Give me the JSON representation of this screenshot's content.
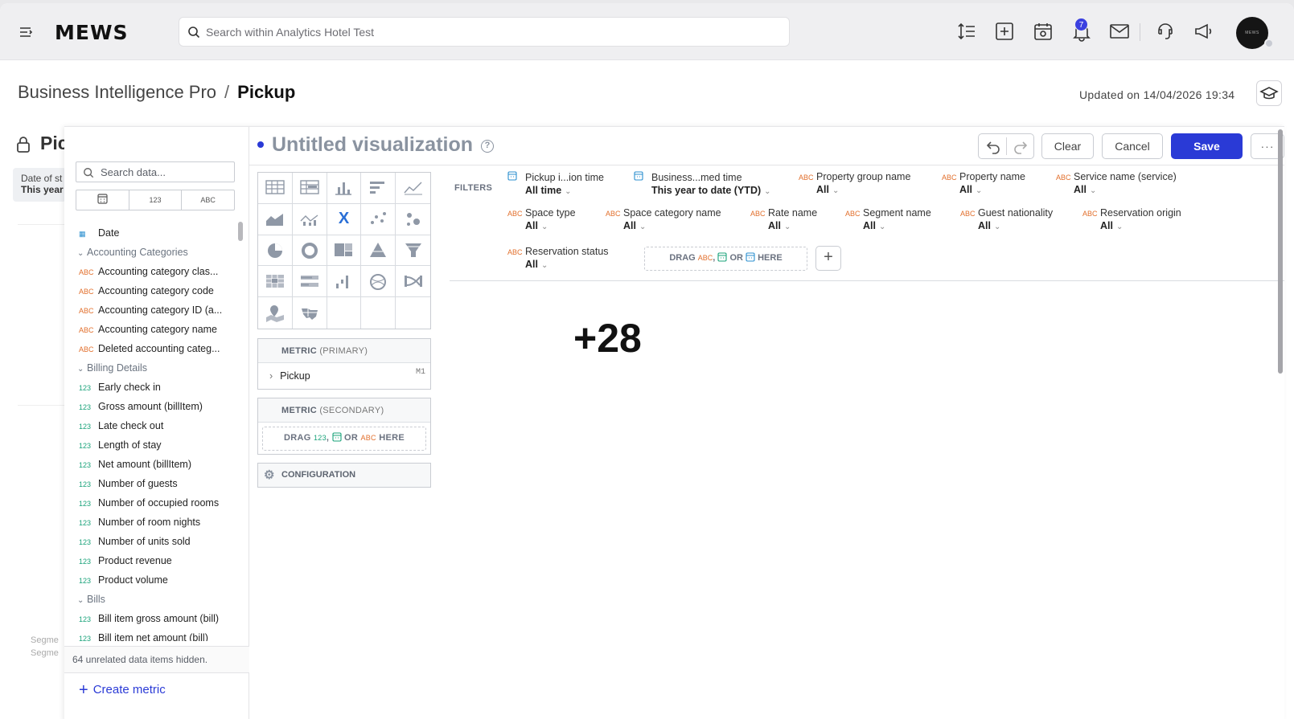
{
  "topbar": {
    "logo": "MEWS",
    "search_placeholder": "Search within Analytics Hotel Test",
    "notification_count": "7",
    "avatar_text": "MEWS"
  },
  "breadcrumb": {
    "parent": "Business Intelligence Pro",
    "separator": "/",
    "current": "Pickup"
  },
  "updated": "Updated on 14/04/2026 19:34",
  "underlying": {
    "title": "Pic",
    "date_label": "Date of st",
    "date_value": "This year",
    "segment_label1": "Segme",
    "segment_label2": "Segme"
  },
  "data_panel": {
    "search_placeholder": "Search data...",
    "type_tabs": [
      "",
      "123",
      "ABC"
    ],
    "items": [
      {
        "kind": "item",
        "type": "date",
        "icon": "▦",
        "label": "Date"
      },
      {
        "kind": "group",
        "label": "Accounting Categories"
      },
      {
        "kind": "item",
        "type": "abc",
        "icon": "ABC",
        "label": "Accounting category clas..."
      },
      {
        "kind": "item",
        "type": "abc",
        "icon": "ABC",
        "label": "Accounting category code"
      },
      {
        "kind": "item",
        "type": "abc",
        "icon": "ABC",
        "label": "Accounting category ID (a..."
      },
      {
        "kind": "item",
        "type": "abc",
        "icon": "ABC",
        "label": "Accounting category name"
      },
      {
        "kind": "item",
        "type": "abc",
        "icon": "ABC",
        "label": "Deleted accounting categ..."
      },
      {
        "kind": "group",
        "label": "Billing Details"
      },
      {
        "kind": "item",
        "type": "num",
        "icon": "123",
        "label": "Early check in"
      },
      {
        "kind": "item",
        "type": "num",
        "icon": "123",
        "label": "Gross amount (billItem)"
      },
      {
        "kind": "item",
        "type": "num",
        "icon": "123",
        "label": "Late check out"
      },
      {
        "kind": "item",
        "type": "num",
        "icon": "123",
        "label": "Length of stay"
      },
      {
        "kind": "item",
        "type": "num",
        "icon": "123",
        "label": "Net amount (billItem)"
      },
      {
        "kind": "item",
        "type": "num",
        "icon": "123",
        "label": "Number of guests"
      },
      {
        "kind": "item",
        "type": "num",
        "icon": "123",
        "label": "Number of occupied rooms"
      },
      {
        "kind": "item",
        "type": "num",
        "icon": "123",
        "label": "Number of room nights"
      },
      {
        "kind": "item",
        "type": "num",
        "icon": "123",
        "label": "Number of units sold"
      },
      {
        "kind": "item",
        "type": "num",
        "icon": "123",
        "label": "Product revenue"
      },
      {
        "kind": "item",
        "type": "num",
        "icon": "123",
        "label": "Product volume"
      },
      {
        "kind": "group",
        "label": "Bills"
      },
      {
        "kind": "item",
        "type": "num",
        "icon": "123",
        "label": "Bill item gross amount (bill)"
      },
      {
        "kind": "item",
        "type": "num",
        "icon": "123",
        "label": "Bill item net amount (bill)"
      }
    ],
    "hidden_note": "64 unrelated data items hidden.",
    "create_metric": "Create metric"
  },
  "editor": {
    "title": "Untitled visualization",
    "help": "?",
    "clear": "Clear",
    "cancel": "Cancel",
    "save": "Save",
    "more": "···"
  },
  "chart_types": [
    "table-icon",
    "pivot-table-icon",
    "column-chart-icon",
    "bar-chart-icon",
    "line-chart-icon",
    "area-chart-icon",
    "combo-chart-icon",
    "headline-icon",
    "scatter-plot-icon",
    "bubble-chart-icon",
    "pie-chart-icon",
    "donut-chart-icon",
    "treemap-icon",
    "pyramid-chart-icon",
    "funnel-chart-icon",
    "heatmap-icon",
    "bullet-chart-icon",
    "waterfall-chart-icon",
    "dependency-wheel-icon",
    "sankey-icon",
    "pushpin-map-icon",
    "region-map-icon",
    "empty",
    "empty",
    "empty"
  ],
  "headline_glyph": "X",
  "metric_primary": {
    "title": "METRIC",
    "qualifier": "(PRIMARY)",
    "item": "Pickup",
    "tag": "M1"
  },
  "metric_secondary": {
    "title": "METRIC",
    "qualifier": "(SECONDARY)",
    "drop_drag": "DRAG",
    "drop_num": "123",
    "drop_comma": ",",
    "drop_or": "OR",
    "drop_abc": "ABC",
    "drop_here": "HERE"
  },
  "configuration": "CONFIGURATION",
  "filters": {
    "label": "FILTERS",
    "items": [
      {
        "type": "date",
        "name": "Pickup i...ion time",
        "value": "All time"
      },
      {
        "type": "date",
        "name": "Business...med time",
        "value": "This year to date (YTD)"
      },
      {
        "type": "abc",
        "name": "Property group name",
        "value": "All"
      },
      {
        "type": "abc",
        "name": "Property name",
        "value": "All"
      },
      {
        "type": "abc",
        "name": "Service name (service)",
        "value": "All"
      },
      {
        "type": "abc",
        "name": "Space type",
        "value": "All"
      },
      {
        "type": "abc",
        "name": "Space category name",
        "value": "All"
      },
      {
        "type": "abc",
        "name": "Rate name",
        "value": "All"
      },
      {
        "type": "abc",
        "name": "Segment name",
        "value": "All"
      },
      {
        "type": "abc",
        "name": "Guest nationality",
        "value": "All"
      },
      {
        "type": "abc",
        "name": "Reservation origin",
        "value": "All"
      },
      {
        "type": "abc",
        "name": "Reservation status",
        "value": "All"
      }
    ],
    "drop_drag": "DRAG",
    "drop_abc": "ABC",
    "drop_comma": ",",
    "drop_or": "OR",
    "drop_here": "HERE",
    "add": "+"
  },
  "kpi": "+28",
  "colors": {
    "accent": "#2a3ad6",
    "abc": "#e26f2c",
    "numeric": "#1aa37a",
    "date": "#2b8fcf"
  }
}
